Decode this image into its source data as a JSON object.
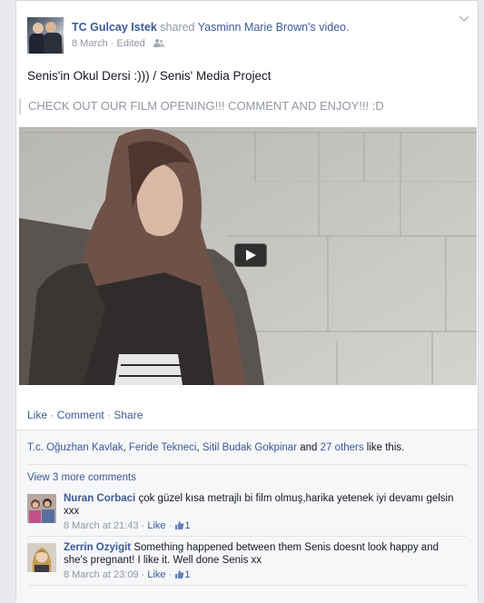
{
  "post": {
    "author": "TC Gulcay Istek",
    "shared_text": "shared",
    "shared_owner": "Yasminn Marie Brown",
    "shared_suffix": "'s video.",
    "date": "8 March",
    "separator": "·",
    "edited": "Edited",
    "text": "Senis'in Okul Dersi :))) / Senis' Media Project",
    "quote": "CHECK OUT OUR FILM OPENING!!! COMMENT AND ENJOY!!! :D"
  },
  "actions": {
    "like": "Like",
    "comment": "Comment",
    "share": "Share",
    "sep": " · "
  },
  "likes": {
    "names": [
      "T.c. Oğuzhan Kavlak",
      "Feride Tekneci",
      "Sitil Budak Gokpinar"
    ],
    "comma": ", ",
    "and": " and ",
    "others": "27 others",
    "suffix": " like this."
  },
  "view_more": "View 3 more comments",
  "comments": [
    {
      "author": "Nuran Corbaci",
      "text": "çok güzel kısa metrajlı bi film olmuş,harika yetenek iyi devamı gelsin xxx",
      "time": "8 March at 21:43",
      "like": "Like",
      "count": "1"
    },
    {
      "author": "Zerrin Ozyigit",
      "text": "Something happened between them Senis doesnt look happy and she's pregnant! I like it. Well done Senis xx",
      "time": "8 March at 23:09",
      "like": "Like",
      "count": "1"
    }
  ],
  "icons": {
    "chevron": "chevron-down-icon",
    "audience": "friends-audience-icon",
    "play": "play-icon",
    "thumbs_up": "thumbs-up-icon"
  },
  "colors": {
    "link": "#3b5998",
    "muted": "#9197a3",
    "background": "#e9eaed"
  }
}
